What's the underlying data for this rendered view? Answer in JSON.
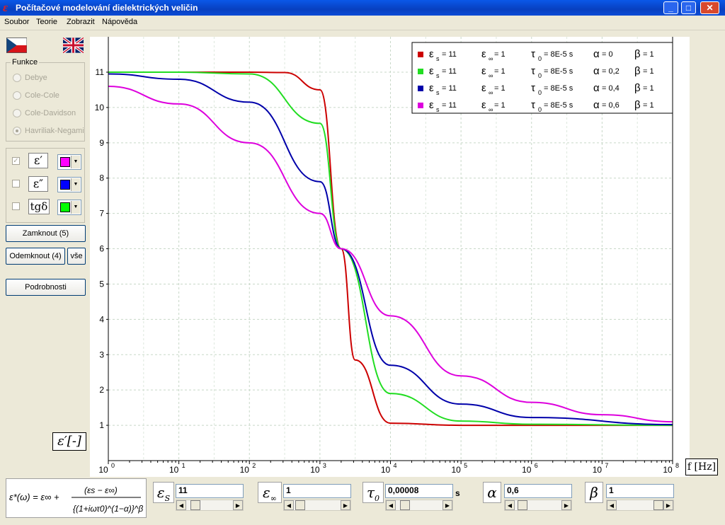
{
  "window": {
    "title": "Počítačové modelování dielektrických veličin",
    "app_icon": "ε",
    "controls": {
      "minimize": "_",
      "maximize": "□",
      "close": "✕"
    }
  },
  "menu": [
    "Soubor",
    "Teorie",
    "Zobrazit",
    "Nápověda"
  ],
  "flags": {
    "cz": "czech-flag-icon",
    "en": "uk-flag-icon"
  },
  "funkce": {
    "legend": "Funkce",
    "options": [
      "Debye",
      "Cole-Cole",
      "Cole-Davidson",
      "Havriliak-Negami"
    ],
    "selected": "Havriliak-Negami"
  },
  "quantities": [
    {
      "label": "ε′",
      "checked": true,
      "color": "#ff00ff"
    },
    {
      "label": "ε″",
      "checked": false,
      "color": "#0000ff"
    },
    {
      "label": "tgδ",
      "checked": false,
      "color": "#00ff00"
    }
  ],
  "buttons": {
    "lock": "Zamknout (5)",
    "unlock": "Odemknout (4)",
    "all": "vše",
    "details": "Podrobnosti"
  },
  "y_unit_label": "ε′[-]",
  "x_unit_label": "f [Hz]",
  "legend_rows": [
    {
      "color": "#cc0000",
      "es": "= 11",
      "einf": "= 1",
      "tau": "= 8E-5 s",
      "alpha": "= 0",
      "beta": "= 1"
    },
    {
      "color": "#22dd22",
      "es": "= 11",
      "einf": "= 1",
      "tau": "= 8E-5 s",
      "alpha": "= 0,2",
      "beta": "= 1"
    },
    {
      "color": "#0000aa",
      "es": "= 11",
      "einf": "= 1",
      "tau": "= 8E-5 s",
      "alpha": "= 0,4",
      "beta": "= 1"
    },
    {
      "color": "#dd00dd",
      "es": "= 11",
      "einf": "= 1",
      "tau": "= 8E-5 s",
      "alpha": "= 0,6",
      "beta": "= 1"
    }
  ],
  "chart_data": {
    "type": "line",
    "x_scale": "log",
    "xlim": [
      1,
      100000000
    ],
    "ylim": [
      0,
      11
    ],
    "yticks": [
      "1",
      "2",
      "3",
      "4",
      "5",
      "6",
      "7",
      "8",
      "9",
      "10",
      "11"
    ],
    "xtick_exponents": [
      "0",
      "1",
      "2",
      "3",
      "4",
      "5",
      "6",
      "7",
      "8"
    ],
    "grid": true,
    "legend_position": "top-right",
    "series": [
      {
        "color": "#cc0000",
        "x": [
          1,
          10,
          100,
          316,
          1000,
          2000,
          3162,
          10000,
          100000,
          100000000
        ],
        "y": [
          11,
          11,
          11,
          10.99,
          10.5,
          6.0,
          2.85,
          1.06,
          1.0,
          1.0
        ]
      },
      {
        "color": "#22dd22",
        "x": [
          1,
          10,
          100,
          1000,
          2000,
          10000,
          100000,
          1000000,
          100000000
        ],
        "y": [
          11,
          11,
          10.95,
          9.55,
          6.0,
          1.9,
          1.12,
          1.03,
          1.0
        ]
      },
      {
        "color": "#0000aa",
        "x": [
          1,
          10,
          100,
          1000,
          2000,
          10000,
          100000,
          1000000,
          100000000
        ],
        "y": [
          10.95,
          10.8,
          10.15,
          7.9,
          6.0,
          2.7,
          1.6,
          1.22,
          1.02
        ]
      },
      {
        "color": "#dd00dd",
        "x": [
          1,
          10,
          100,
          1000,
          2000,
          10000,
          100000,
          1000000,
          10000000,
          100000000
        ],
        "y": [
          10.6,
          10.1,
          9.0,
          7.0,
          6.0,
          4.1,
          2.4,
          1.65,
          1.3,
          1.1
        ]
      }
    ]
  },
  "params": [
    {
      "symbol": "ε",
      "sub": "S",
      "value": "11",
      "unit": ""
    },
    {
      "symbol": "ε",
      "sub": "∞",
      "value": "1",
      "unit": ""
    },
    {
      "symbol": "τ",
      "sub": "0",
      "value": "0,00008",
      "unit": "s"
    },
    {
      "symbol": "α",
      "sub": "",
      "value": "0,6",
      "unit": ""
    },
    {
      "symbol": "β",
      "sub": "",
      "value": "1",
      "unit": ""
    }
  ]
}
